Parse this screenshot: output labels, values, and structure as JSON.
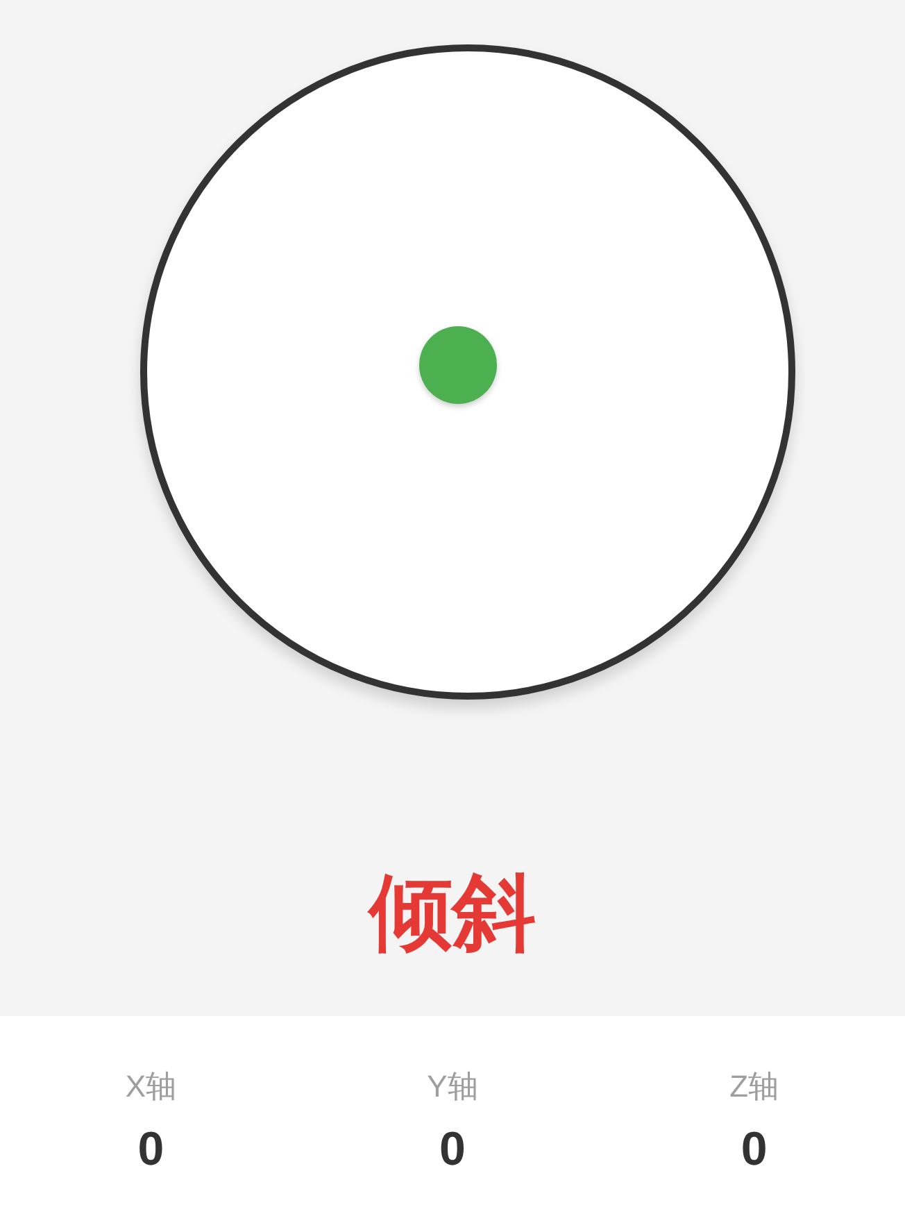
{
  "status": "倾斜",
  "axes": [
    {
      "label": "X轴",
      "value": "0"
    },
    {
      "label": "Y轴",
      "value": "0"
    },
    {
      "label": "Z轴",
      "value": "0"
    }
  ]
}
